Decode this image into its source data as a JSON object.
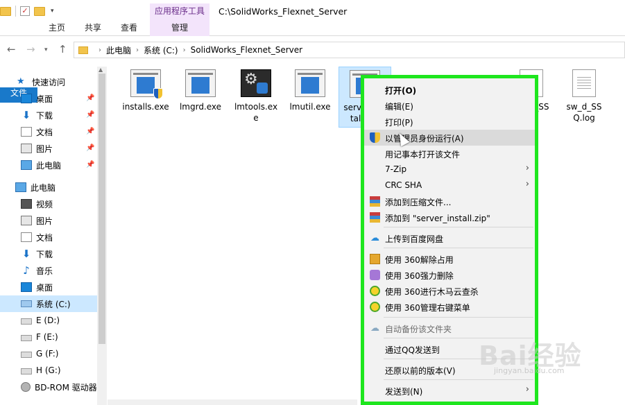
{
  "window": {
    "title": "C:\\SolidWorks_Flexnet_Server",
    "tool_tab_title": "应用程序工具"
  },
  "ribbon": {
    "tabs": [
      {
        "label": "文件"
      },
      {
        "label": "主页"
      },
      {
        "label": "共享"
      },
      {
        "label": "查看"
      },
      {
        "label": "管理"
      }
    ]
  },
  "address": {
    "crumbs": [
      "此电脑",
      "系统 (C:)",
      "SolidWorks_Flexnet_Server"
    ]
  },
  "nav": {
    "quick_access": "快速访问",
    "pinned": [
      "桌面",
      "下载",
      "文档",
      "图片",
      "此电脑"
    ],
    "this_pc": "此电脑",
    "pc_items": [
      "视频",
      "图片",
      "文档",
      "下载",
      "音乐",
      "桌面"
    ],
    "drives": [
      "系统 (C:)",
      "E (D:)",
      "F (E:)",
      "G (F:)",
      "H (G:)",
      "BD-ROM 驱动器"
    ]
  },
  "files": [
    {
      "name": "installs.exe"
    },
    {
      "name": "lmgrd.exe"
    },
    {
      "name": "lmtools.exe"
    },
    {
      "name": "lmutil.exe"
    },
    {
      "name": "server_install.bat"
    },
    {
      "name": "sw_d_SSQ.lic"
    },
    {
      "name": "sw_d_SSQ.log"
    }
  ],
  "context_menu": {
    "items": [
      "打开(O)",
      "编辑(E)",
      "打印(P)",
      "以管理员身份运行(A)",
      "用记事本打开该文件",
      "7-Zip",
      "CRC SHA",
      "添加到压缩文件...",
      "添加到 \"server_install.zip\"",
      "上传到百度网盘",
      "使用 360解除占用",
      "使用 360强力删除",
      "使用 360进行木马云查杀",
      "使用 360管理右键菜单",
      "自动备份该文件夹",
      "通过QQ发送到",
      "还原以前的版本(V)",
      "发送到(N)"
    ]
  },
  "watermark": {
    "brand": "Bai经验",
    "url": "jingyan.baidu.com"
  },
  "colors": {
    "accent": "#1979ca",
    "highlight_border": "#1ee61e",
    "tool_tab": "#f3e4fb"
  }
}
